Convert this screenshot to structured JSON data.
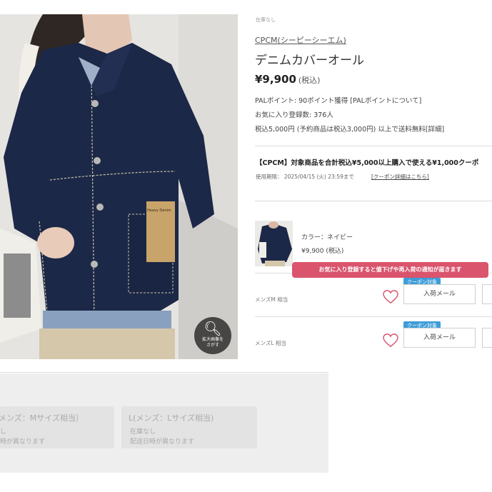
{
  "product": {
    "stock_note": "在庫なし",
    "brand": "CPCM(シーピーシーエム)",
    "title": "デニムカバーオール",
    "price": "¥9,900",
    "price_tax": "(税込)",
    "points": "PALポイント: 90ポイント獲得 [PALポイントについて]",
    "favorite_count": "お気に入り登録数: 376人",
    "shipping": "税込5,000円 (予約商品は税込3,000円) 以上で送料無料[詳細]",
    "zoom_button": {
      "line1": "拡大画像を",
      "line2": "さがす"
    },
    "tag_text": "Heavy Denim"
  },
  "coupon": {
    "title": "【CPCM】対象商品を合計税込¥5,000以上購入で使える¥1,000クーポ",
    "expiry": "使用期限： 2025/04/15 (火) 23:59まで",
    "detail_link": "[クーポン詳細はこちら]"
  },
  "variant": {
    "color": "カラー：ネイビー",
    "price": "¥9,900 (税込)",
    "notify_tooltip": "お気に入り登録すると値下げや再入荷の通知が届きます",
    "sizes": [
      {
        "label": "メンズM 相当",
        "badge": "クーポン対象",
        "mail_button": "入荷メール"
      },
      {
        "label": "メンズL 相当",
        "badge": "クーポン対象",
        "mail_button": "入荷メール"
      }
    ]
  },
  "size_panel": {
    "cards": [
      {
        "name": "メンズ：Mサイズ相当）",
        "line1": "し",
        "line2": "時が異なります"
      },
      {
        "name": "L(メンズ：Lサイズ相当)",
        "line1": "在庫なし",
        "line2": "配送日時が異なります"
      }
    ]
  },
  "colors": {
    "denim": "#1c2847",
    "tooltip": "#d9546c",
    "badge": "#3d9dd8",
    "heart": "#d9546c"
  }
}
